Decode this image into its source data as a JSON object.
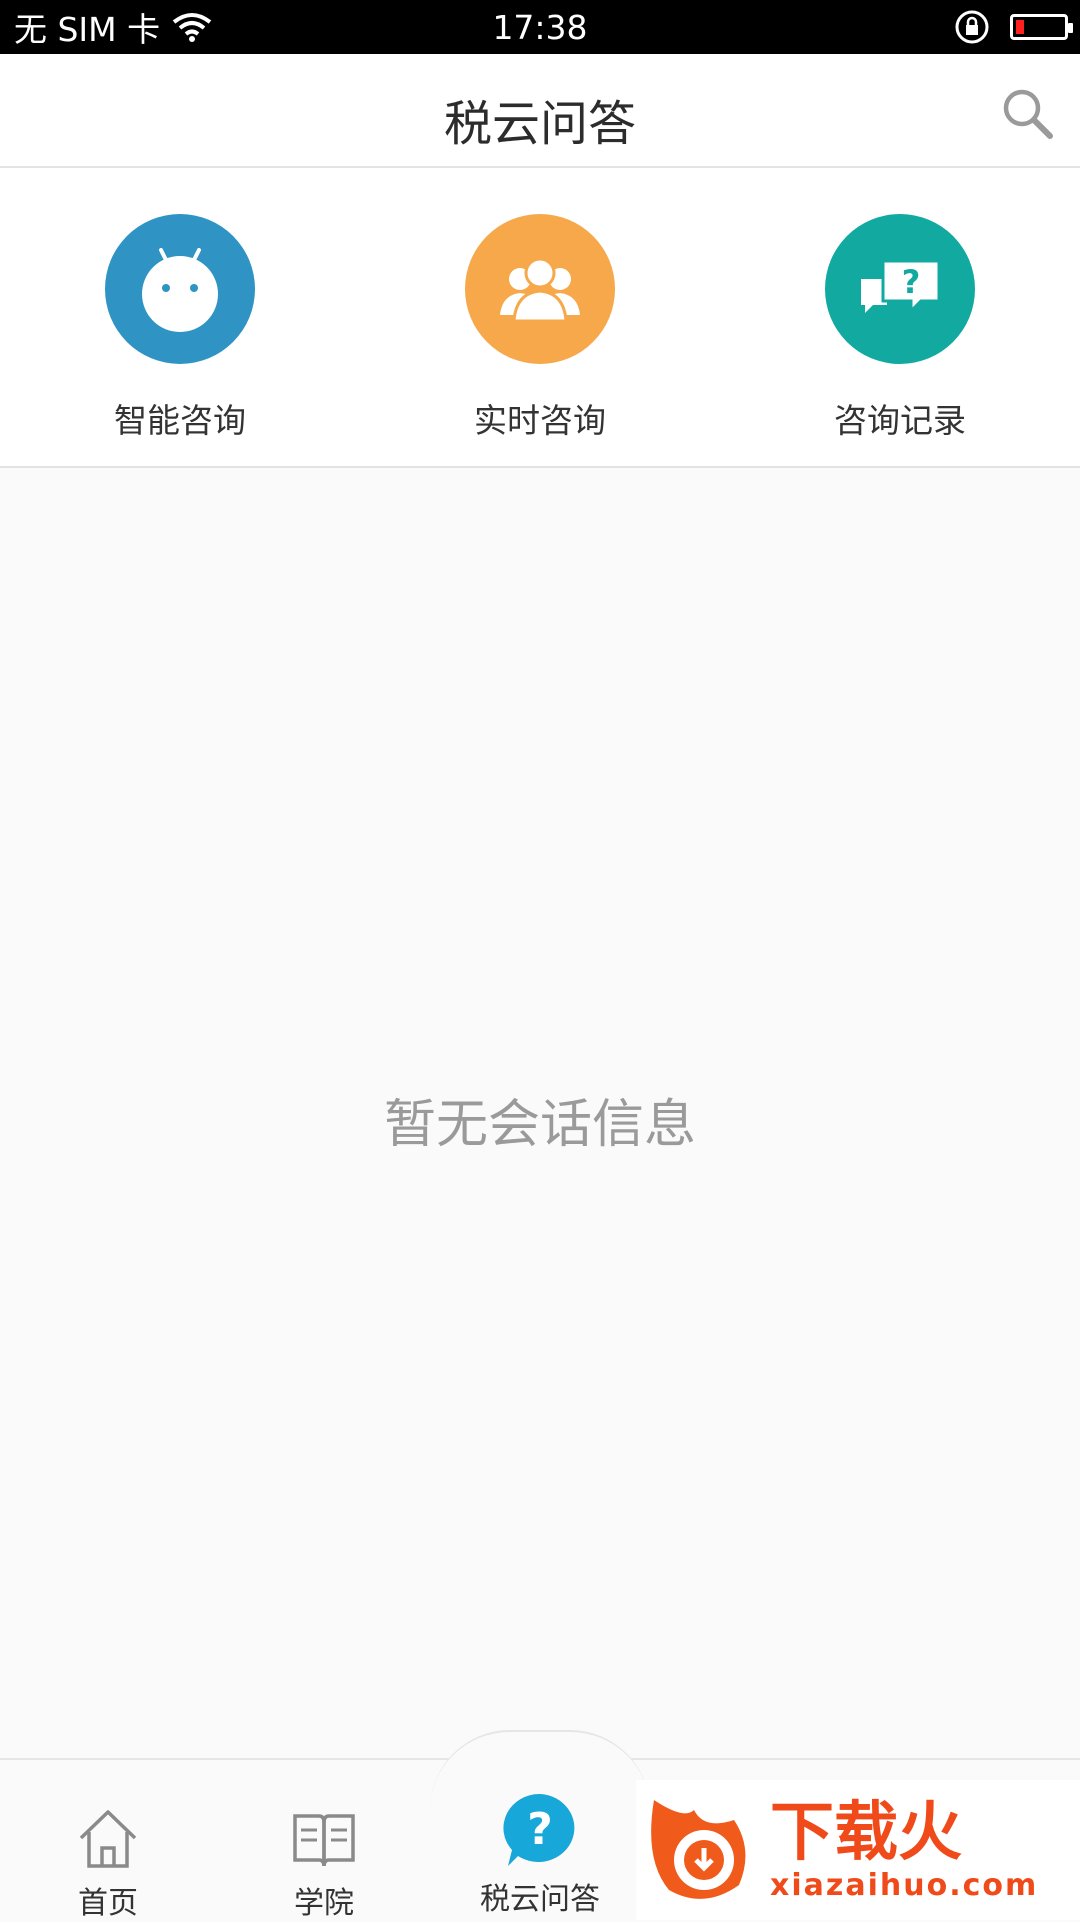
{
  "status_bar": {
    "carrier": "无 SIM 卡",
    "time": "17:38"
  },
  "header": {
    "title": "税云问答"
  },
  "quick_actions": [
    {
      "label": "智能咨询",
      "icon": "robot-icon",
      "color": "#2f94c4"
    },
    {
      "label": "实时咨询",
      "icon": "group-icon",
      "color": "#f6a84a"
    },
    {
      "label": "咨询记录",
      "icon": "chat-question-icon",
      "color": "#12a9a1"
    }
  ],
  "empty_state": {
    "text": "暂无会话信息"
  },
  "bottom_nav": {
    "items": [
      {
        "label": "首页",
        "icon": "home-icon"
      },
      {
        "label": "学院",
        "icon": "book-icon"
      },
      {
        "label": "税云问答",
        "icon": "question-bubble-icon",
        "active": true
      }
    ],
    "active_color": "#17a7d8"
  },
  "watermark": {
    "cn": "下载火",
    "en": "xiazaihuo.com"
  }
}
